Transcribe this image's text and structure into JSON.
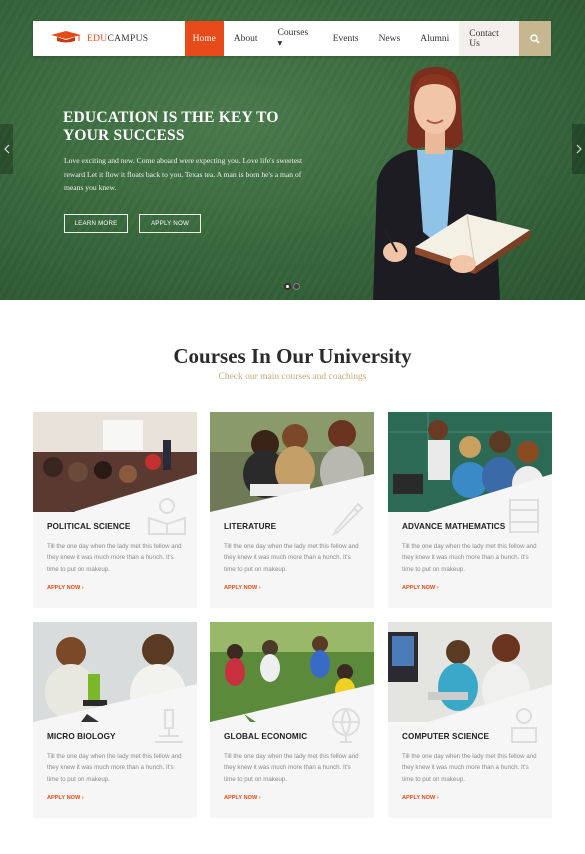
{
  "brand": {
    "part1": "EDU",
    "part2": "CAMPUS"
  },
  "nav": {
    "items": [
      {
        "label": "Home"
      },
      {
        "label": "About"
      },
      {
        "label": "Courses ▾"
      },
      {
        "label": "Events"
      },
      {
        "label": "News"
      },
      {
        "label": "Alumni"
      },
      {
        "label": "Contact Us"
      }
    ]
  },
  "hero": {
    "title": "EDUCATION IS THE KEY TO YOUR SUCCESS",
    "text": "Love exciting and new. Come aboard were expecting you. Love life's sweetest reward Let it flow it floats back to you. Texas tea. A man is born he's a man of means you knew.",
    "learn_more": "LEARN MORE",
    "apply_now": "APPLY NOW"
  },
  "section": {
    "title": "Courses In Our University",
    "subtitle": "Check our main courses and coachings"
  },
  "courses": [
    {
      "title": "POLITICAL SCIENCE",
      "desc": "Till the one day when the lady met this fellow and they knew it was much more than a hunch. It's time to put on makeup.",
      "apply": "APPLY NOW ›"
    },
    {
      "title": "LITERATURE",
      "desc": "Till the one day when the lady met this fellow and they knew it was much more than a hunch. It's time to put on makeup.",
      "apply": "APPLY NOW ›"
    },
    {
      "title": "ADVANCE MATHEMATICS",
      "desc": "Till the one day when the lady met this fellow and they knew it was much more than a hunch. It's time to put on makeup.",
      "apply": "APPLY NOW ›"
    },
    {
      "title": "MICRO BIOLOGY",
      "desc": "Till the one day when the lady met this fellow and they knew it was much more than a hunch. It's time to put on makeup.",
      "apply": "APPLY NOW ›"
    },
    {
      "title": "GLOBAL ECONOMIC",
      "desc": "Till the one day when the lady met this fellow and they knew it was much more than a hunch. It's time to put on makeup.",
      "apply": "APPLY NOW ›"
    },
    {
      "title": "COMPUTER SCIENCE",
      "desc": "Till the one day when the lady met this fellow and they knew it was much more than a hunch. It's time to put on makeup.",
      "apply": "APPLY NOW ›"
    }
  ],
  "colors": {
    "accent": "#e64a19",
    "gold": "#c4ab7a",
    "chalkboard": "#3a6a3e"
  }
}
